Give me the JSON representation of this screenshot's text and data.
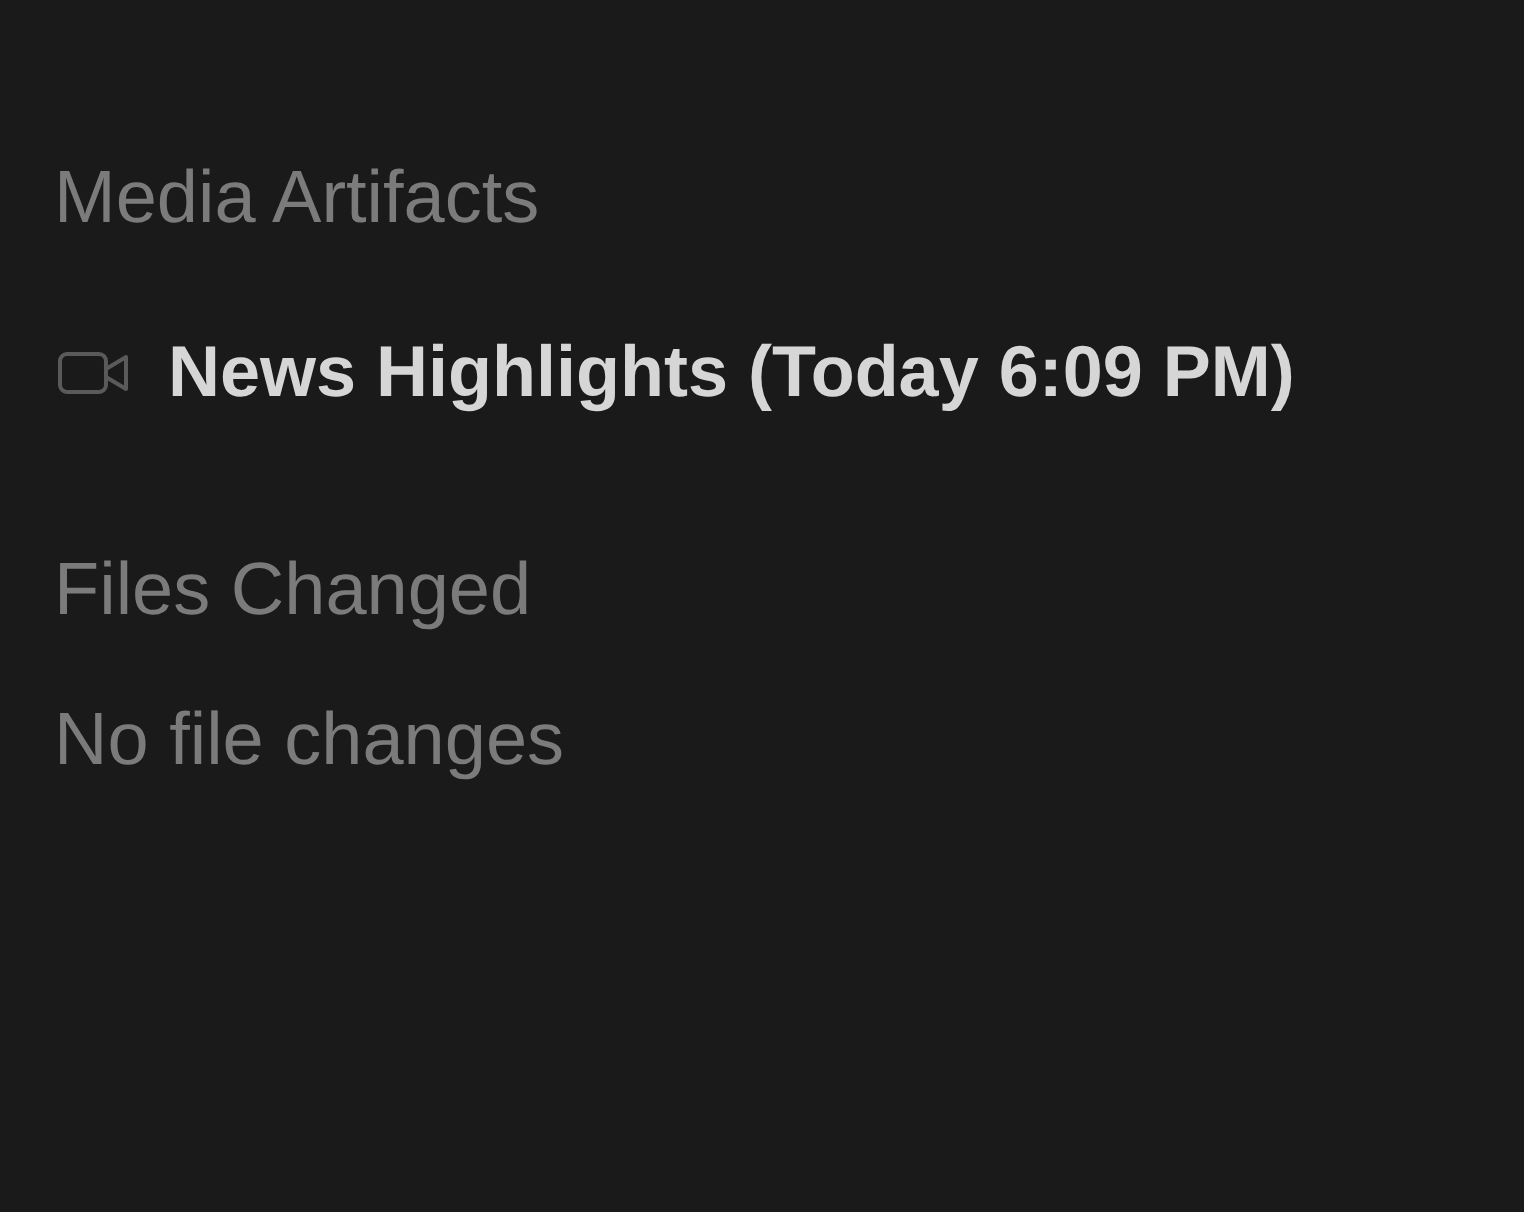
{
  "media_artifacts": {
    "heading": "Media Artifacts",
    "items": [
      {
        "kind": "video",
        "title": "News Highlights (Today 6:09 PM)"
      }
    ]
  },
  "files_changed": {
    "heading": "Files Changed",
    "empty_message": "No file changes"
  }
}
